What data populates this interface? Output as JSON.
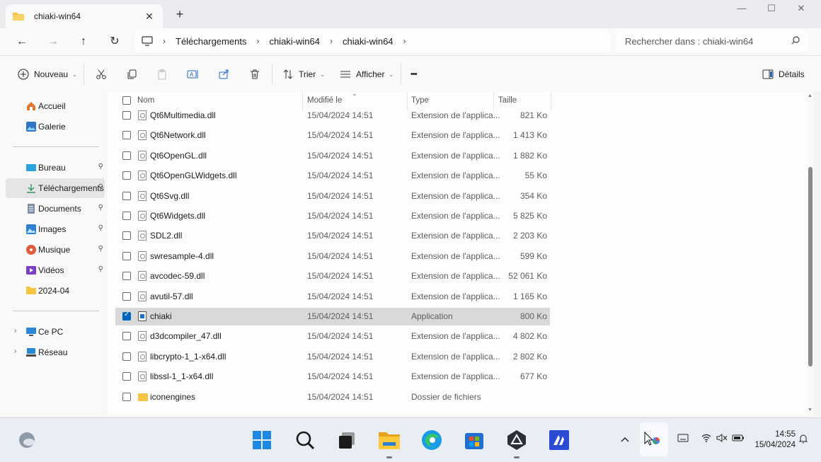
{
  "window": {
    "tab_title": "chiaki-win64",
    "tab_close_glyph": "✕",
    "new_tab_glyph": "+",
    "controls": {
      "minimize": "—",
      "maximize": "☐",
      "close": "✕"
    }
  },
  "nav": {
    "back_glyph": "←",
    "forward_glyph": "→",
    "up_glyph": "↑",
    "refresh_glyph": "↻"
  },
  "breadcrumb": {
    "items": [
      "Téléchargements",
      "chiaki-win64",
      "chiaki-win64"
    ],
    "separator": "›"
  },
  "search": {
    "placeholder": "Rechercher dans : chiaki-win64"
  },
  "commands": {
    "new": "Nouveau",
    "sort": "Trier",
    "view": "Afficher",
    "more": "•••",
    "details": "Détails"
  },
  "sidebar": {
    "items": [
      {
        "label": "Accueil",
        "icon": "home-icon",
        "color": "#e0772f"
      },
      {
        "label": "Galerie",
        "icon": "gallery-icon",
        "color": "#2f74c7"
      },
      {
        "label": "Bureau",
        "icon": "desktop-icon",
        "color": "#2aa3e0",
        "pinned": true
      },
      {
        "label": "Téléchargements",
        "icon": "download-icon",
        "color": "#2b9c5a",
        "pinned": true,
        "selected": true
      },
      {
        "label": "Documents",
        "icon": "documents-icon",
        "color": "#7d8fa6",
        "pinned": true
      },
      {
        "label": "Images",
        "icon": "pictures-icon",
        "color": "#2d7fd3",
        "pinned": true
      },
      {
        "label": "Musique",
        "icon": "music-icon",
        "color": "#e25a3a",
        "pinned": true
      },
      {
        "label": "Vidéos",
        "icon": "videos-icon",
        "color": "#7a3fc4",
        "pinned": true
      },
      {
        "label": "2024-04",
        "icon": "folder-icon",
        "color": "#f5c542"
      },
      {
        "label": "Ce PC",
        "icon": "pc-icon",
        "color": "#2a86d6"
      },
      {
        "label": "Réseau",
        "icon": "network-icon",
        "color": "#2a86d6"
      }
    ],
    "pin_glyph": "📌",
    "expand_glyph": "›"
  },
  "columns": {
    "name": "Nom",
    "modified": "Modifié le",
    "type": "Type",
    "size": "Taille"
  },
  "files": [
    {
      "name": "Qt6Multimedia.dll",
      "date": "15/04/2024 14:51",
      "type": "Extension de l'applica...",
      "size": "821 Ko",
      "kind": "dll"
    },
    {
      "name": "Qt6Network.dll",
      "date": "15/04/2024 14:51",
      "type": "Extension de l'applica...",
      "size": "1 413 Ko",
      "kind": "dll"
    },
    {
      "name": "Qt6OpenGL.dll",
      "date": "15/04/2024 14:51",
      "type": "Extension de l'applica...",
      "size": "1 882 Ko",
      "kind": "dll"
    },
    {
      "name": "Qt6OpenGLWidgets.dll",
      "date": "15/04/2024 14:51",
      "type": "Extension de l'applica...",
      "size": "55 Ko",
      "kind": "dll"
    },
    {
      "name": "Qt6Svg.dll",
      "date": "15/04/2024 14:51",
      "type": "Extension de l'applica...",
      "size": "354 Ko",
      "kind": "dll"
    },
    {
      "name": "Qt6Widgets.dll",
      "date": "15/04/2024 14:51",
      "type": "Extension de l'applica...",
      "size": "5 825 Ko",
      "kind": "dll"
    },
    {
      "name": "SDL2.dll",
      "date": "15/04/2024 14:51",
      "type": "Extension de l'applica...",
      "size": "2 203 Ko",
      "kind": "dll"
    },
    {
      "name": "swresample-4.dll",
      "date": "15/04/2024 14:51",
      "type": "Extension de l'applica...",
      "size": "599 Ko",
      "kind": "dll"
    },
    {
      "name": "avcodec-59.dll",
      "date": "15/04/2024 14:51",
      "type": "Extension de l'applica...",
      "size": "52 061 Ko",
      "kind": "dll"
    },
    {
      "name": "avutil-57.dll",
      "date": "15/04/2024 14:51",
      "type": "Extension de l'applica...",
      "size": "1 165 Ko",
      "kind": "dll"
    },
    {
      "name": "chiaki",
      "date": "15/04/2024 14:51",
      "type": "Application",
      "size": "800 Ko",
      "kind": "app",
      "selected": true
    },
    {
      "name": "d3dcompiler_47.dll",
      "date": "15/04/2024 14:51",
      "type": "Extension de l'applica...",
      "size": "4 802 Ko",
      "kind": "dll"
    },
    {
      "name": "libcrypto-1_1-x64.dll",
      "date": "15/04/2024 14:51",
      "type": "Extension de l'applica...",
      "size": "2 802 Ko",
      "kind": "dll"
    },
    {
      "name": "libssl-1_1-x64.dll",
      "date": "15/04/2024 14:51",
      "type": "Extension de l'applica...",
      "size": "677 Ko",
      "kind": "dll"
    },
    {
      "name": "iconengines",
      "date": "15/04/2024 14:51",
      "type": "Dossier de fichiers",
      "size": "",
      "kind": "folder"
    }
  ],
  "taskbar": {
    "apps": [
      {
        "name": "start-button",
        "icon": "windows-logo-icon"
      },
      {
        "name": "search-button",
        "icon": "search-icon"
      },
      {
        "name": "task-view-button",
        "icon": "task-view-icon"
      },
      {
        "name": "file-explorer-app",
        "icon": "folder-icon",
        "running": true
      },
      {
        "name": "edge-app",
        "icon": "edge-icon"
      },
      {
        "name": "store-app",
        "icon": "store-icon"
      },
      {
        "name": "chiaki-app",
        "icon": "chiaki-icon",
        "running": true
      },
      {
        "name": "vscode-app",
        "icon": "vscode-icon"
      }
    ],
    "time": "14:55",
    "date": "15/04/2024",
    "tray_chevron": "^"
  }
}
